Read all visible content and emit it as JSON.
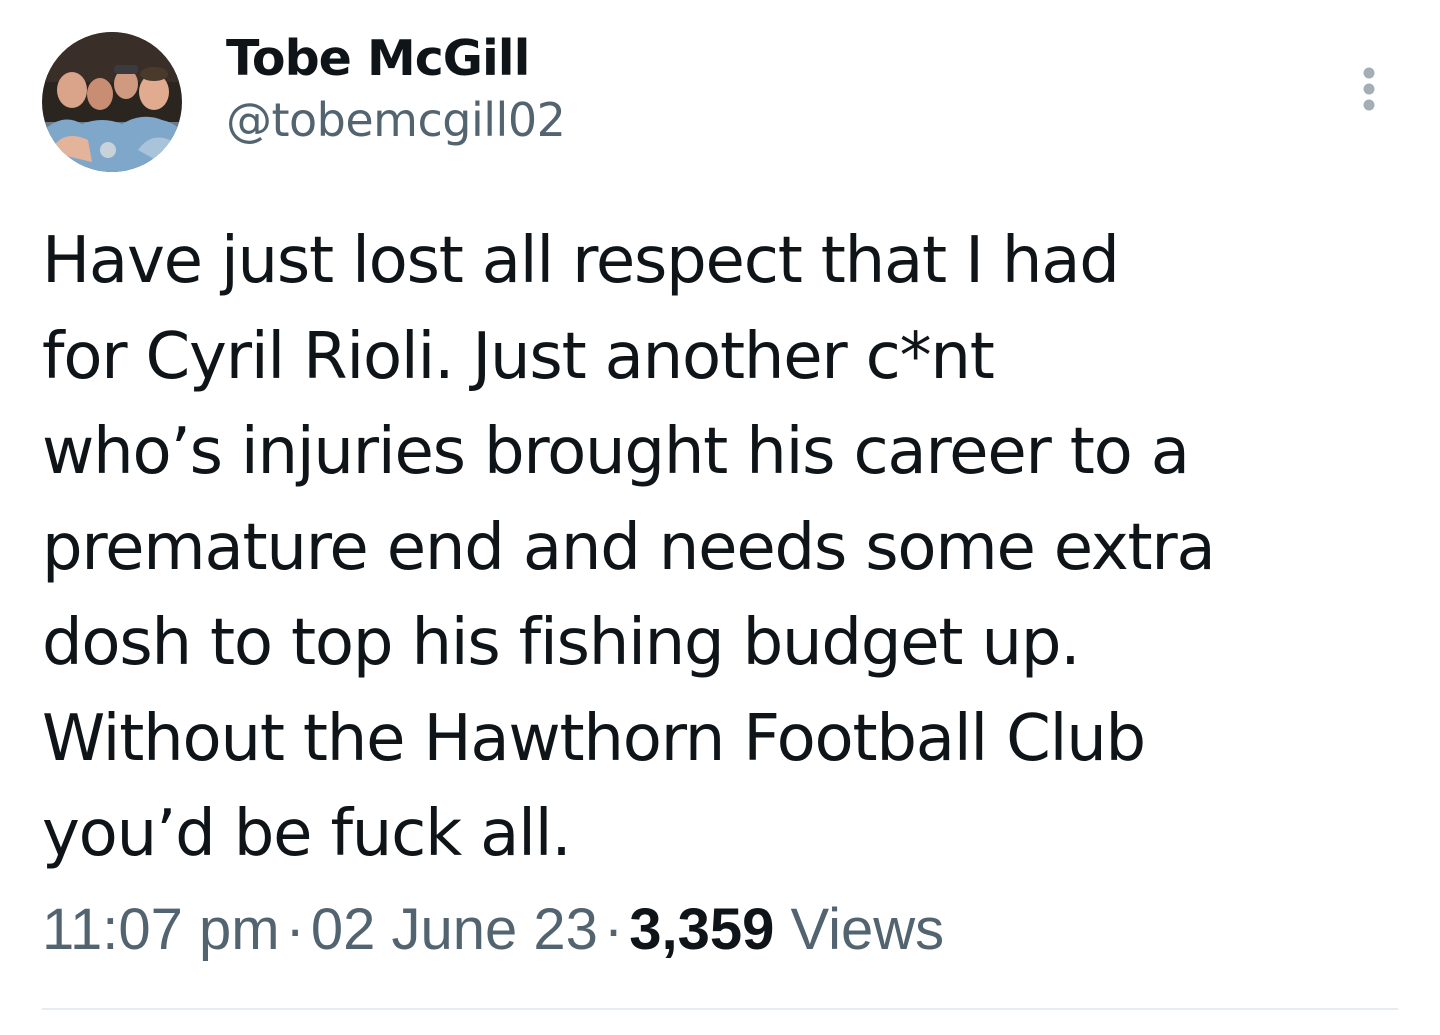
{
  "author": {
    "display_name": "Tobe McGill",
    "handle": "@tobemcgill02",
    "avatar_icon": "profile-photo-group"
  },
  "menu": {
    "icon": "more-vertical-icon"
  },
  "tweet": {
    "lines": [
      "Have just lost all respect that I had",
      "for Cyril Rioli. Just another c*nt",
      "who’s injuries brought his career to a",
      "premature end and needs some extra",
      "dosh to top his fishing budget up.",
      "Without the Hawthorn Football Club",
      "you’d be fuck all."
    ]
  },
  "meta": {
    "time": "11:07 pm",
    "separator": "·",
    "date": "02 June 23",
    "views_count": "3,359",
    "views_label": "Views"
  },
  "colors": {
    "text_primary": "#0f1419",
    "text_secondary": "#536471",
    "divider": "#e6ecf0",
    "menu_dots": "#a3aeb7"
  }
}
